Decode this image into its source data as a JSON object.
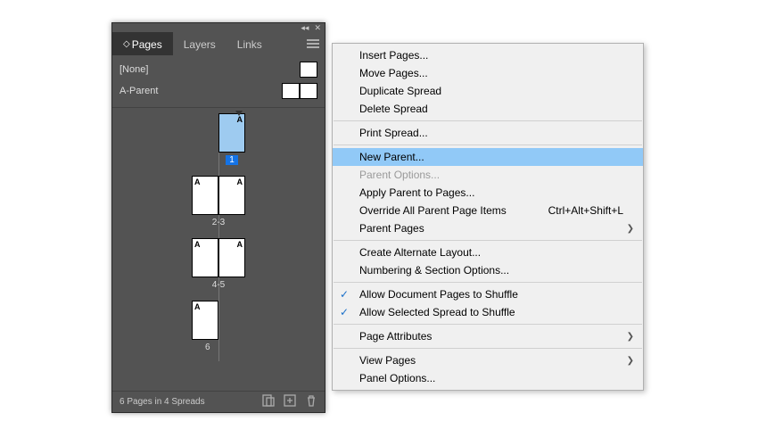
{
  "panel": {
    "tabs": {
      "pages": "Pages",
      "layers": "Layers",
      "links": "Links"
    },
    "masters": {
      "none": "[None]",
      "aparent": "A-Parent"
    },
    "pageLabels": {
      "p1": "1",
      "p23": "2-3",
      "p45": "4-5",
      "p6": "6",
      "aGlyph": "A"
    },
    "footer": {
      "status": "6 Pages in 4 Spreads"
    }
  },
  "menu": {
    "insertPages": "Insert Pages...",
    "movePages": "Move Pages...",
    "dupSpread": "Duplicate Spread",
    "delSpread": "Delete Spread",
    "printSpread": "Print Spread...",
    "newParent": "New Parent...",
    "parentOptions": "Parent Options...",
    "applyParent": "Apply Parent to Pages...",
    "override": "Override All Parent Page Items",
    "overrideKey": "Ctrl+Alt+Shift+L",
    "parentPages": "Parent Pages",
    "createAlt": "Create Alternate Layout...",
    "numbering": "Numbering & Section Options...",
    "allowDoc": "Allow Document Pages to Shuffle",
    "allowSel": "Allow Selected Spread to Shuffle",
    "pageAttr": "Page Attributes",
    "viewPages": "View Pages",
    "panelOptions": "Panel Options..."
  }
}
